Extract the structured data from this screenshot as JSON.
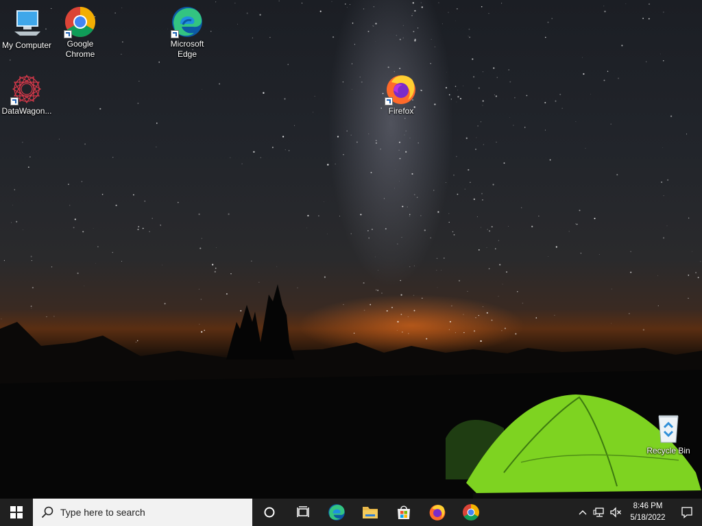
{
  "desktop": {
    "icons": [
      {
        "label": "My Computer"
      },
      {
        "label": "Google\nChrome"
      },
      {
        "label": "Microsoft\nEdge"
      },
      {
        "label": "DataWagon..."
      },
      {
        "label": "Firefox"
      },
      {
        "label": "Recycle Bin"
      }
    ]
  },
  "taskbar": {
    "search_placeholder": "Type here to search",
    "pinned": [
      "Microsoft Edge",
      "File Explorer",
      "Microsoft Store",
      "Firefox",
      "Google Chrome"
    ],
    "clock": {
      "time": "8:46 PM",
      "date": "5/18/2022"
    }
  }
}
